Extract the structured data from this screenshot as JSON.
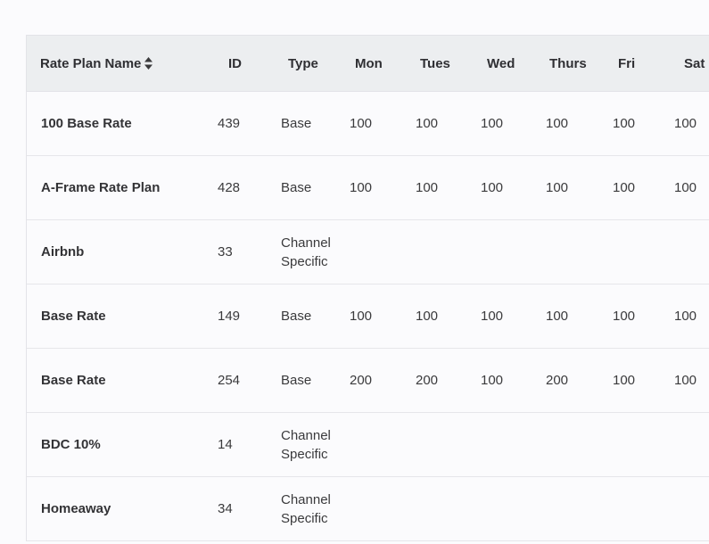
{
  "table": {
    "headers": {
      "name": "Rate Plan Name",
      "id": "ID",
      "type": "Type",
      "mon": "Mon",
      "tue": "Tues",
      "wed": "Wed",
      "thu": "Thurs",
      "fri": "Fri",
      "sat": "Sat"
    },
    "sort_icon": "sort-updown-icon",
    "rows": [
      {
        "name": "100 Base Rate",
        "id": "439",
        "type": "Base",
        "mon": "100",
        "tue": "100",
        "wed": "100",
        "thu": "100",
        "fri": "100",
        "sat": "100"
      },
      {
        "name": "A-Frame Rate Plan",
        "id": "428",
        "type": "Base",
        "mon": "100",
        "tue": "100",
        "wed": "100",
        "thu": "100",
        "fri": "100",
        "sat": "100"
      },
      {
        "name": "Airbnb",
        "id": "33",
        "type": "Channel Specific",
        "mon": "",
        "tue": "",
        "wed": "",
        "thu": "",
        "fri": "",
        "sat": ""
      },
      {
        "name": "Base Rate",
        "id": "149",
        "type": "Base",
        "mon": "100",
        "tue": "100",
        "wed": "100",
        "thu": "100",
        "fri": "100",
        "sat": "100"
      },
      {
        "name": "Base Rate",
        "id": "254",
        "type": "Base",
        "mon": "200",
        "tue": "200",
        "wed": "100",
        "thu": "200",
        "fri": "100",
        "sat": "100"
      },
      {
        "name": "BDC 10%",
        "id": "14",
        "type": "Channel Specific",
        "mon": "",
        "tue": "",
        "wed": "",
        "thu": "",
        "fri": "",
        "sat": ""
      },
      {
        "name": "Homeaway",
        "id": "34",
        "type": "Channel Specific",
        "mon": "",
        "tue": "",
        "wed": "",
        "thu": "",
        "fri": "",
        "sat": ""
      }
    ]
  }
}
